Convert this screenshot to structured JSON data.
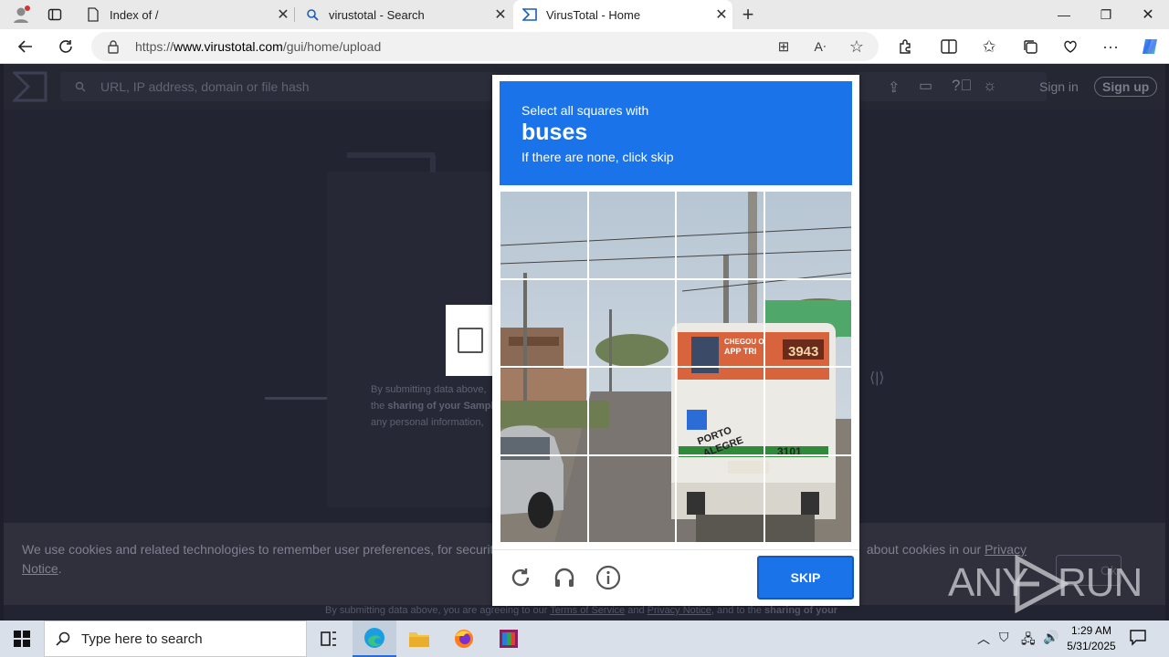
{
  "browser": {
    "tabs": [
      {
        "label": "Index of /",
        "icon": "document-icon"
      },
      {
        "label": "virustotal - Search",
        "icon": "search-icon"
      },
      {
        "label": "VirusTotal - Home",
        "icon": "virustotal-logo-icon"
      }
    ],
    "url_prefix": "https://",
    "url_host": "www.virustotal.com",
    "url_path": "/gui/home/upload"
  },
  "page": {
    "search_placeholder": "URL, IP address, domain or file hash",
    "sign_in": "Sign in",
    "sign_up": "Sign up",
    "card_text_1": "By submitting data above,",
    "card_text_2a": "the ",
    "card_text_2b": "sharing of your Sampl",
    "card_text_3": "any personal information,",
    "cookie_text": "We use cookies and related technologies to remember user preferences, for security, to",
    "cookie_text_2": "about cookies in our",
    "cookie_link_1": "Privacy",
    "cookie_link_2": "Notice",
    "cookie_period": ".",
    "ok_button": "Ok",
    "bottom_text_1": "By submitting data above, you are agreeing to our ",
    "bottom_link_1": "Terms of Service",
    "bottom_and": " and ",
    "bottom_link_2": "Privacy Notice",
    "bottom_text_2": ", and to the ",
    "bottom_bold": "sharing of your"
  },
  "captcha": {
    "instruction": "Select all squares with",
    "target": "buses",
    "hint": "If there are none, click skip",
    "skip_label": "SKIP",
    "bus_texts": {
      "route": "3943",
      "sign_1": "CHEGOU O",
      "sign_2": "APP TRI",
      "city_1": "PORTO",
      "city_2": "ALEGRE",
      "number": "3101"
    }
  },
  "watermark": {
    "text_1": "ANY",
    "text_2": "RUN"
  },
  "taskbar": {
    "search_placeholder": "Type here to search",
    "time": "1:29 AM",
    "date": "5/31/2025"
  }
}
